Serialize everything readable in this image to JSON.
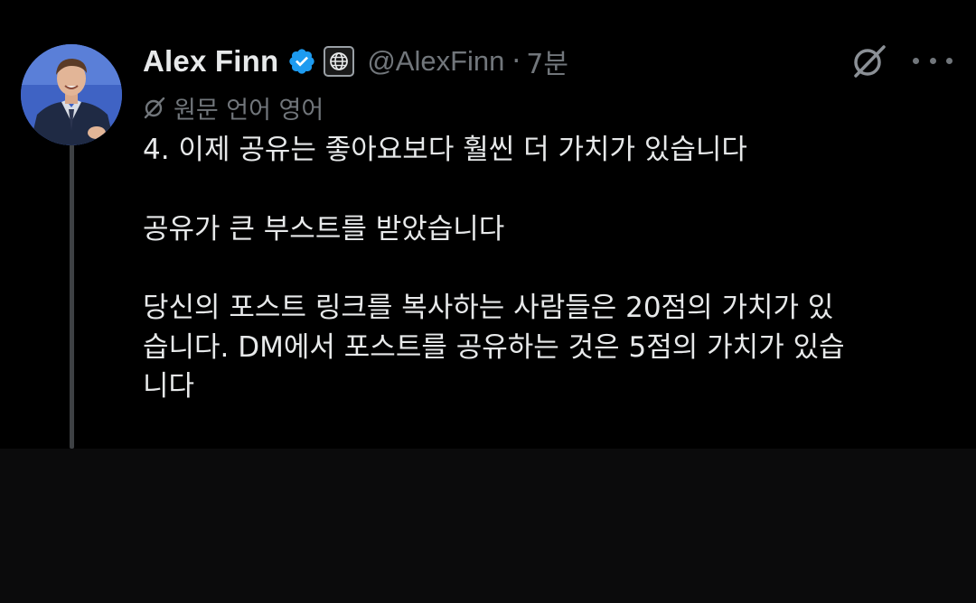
{
  "author": {
    "name": "Alex Finn",
    "handle": "@AlexFinn",
    "separator": "·",
    "time": "7분",
    "verified": true,
    "verified_color": "#1d9bf0"
  },
  "translation": {
    "label": "원문 언어 영어"
  },
  "post": {
    "line1": "4. 이제 공유는 좋아요보다 훨씬 더 가치가 있습니다",
    "line2": "공유가 큰 부스트를 받았습니다",
    "line3a": "당신의 포스트 링크를 복사하는 사람들은 20점의 가치가 있",
    "line3b": "습니다. DM에서 포스트를 공유하는 것은 5점의 가치가 있습",
    "line3c": "니다"
  },
  "icons": {
    "avatar": "avatar-photo",
    "verified": "verified-badge-icon",
    "affiliation": "globe-icon",
    "grok": "grok-icon",
    "more": "more-icon",
    "translate": "translate-icon"
  },
  "colors": {
    "background": "#000000",
    "text": "#e7e9ea",
    "muted": "#71767b",
    "thread_line": "#3e4144"
  }
}
